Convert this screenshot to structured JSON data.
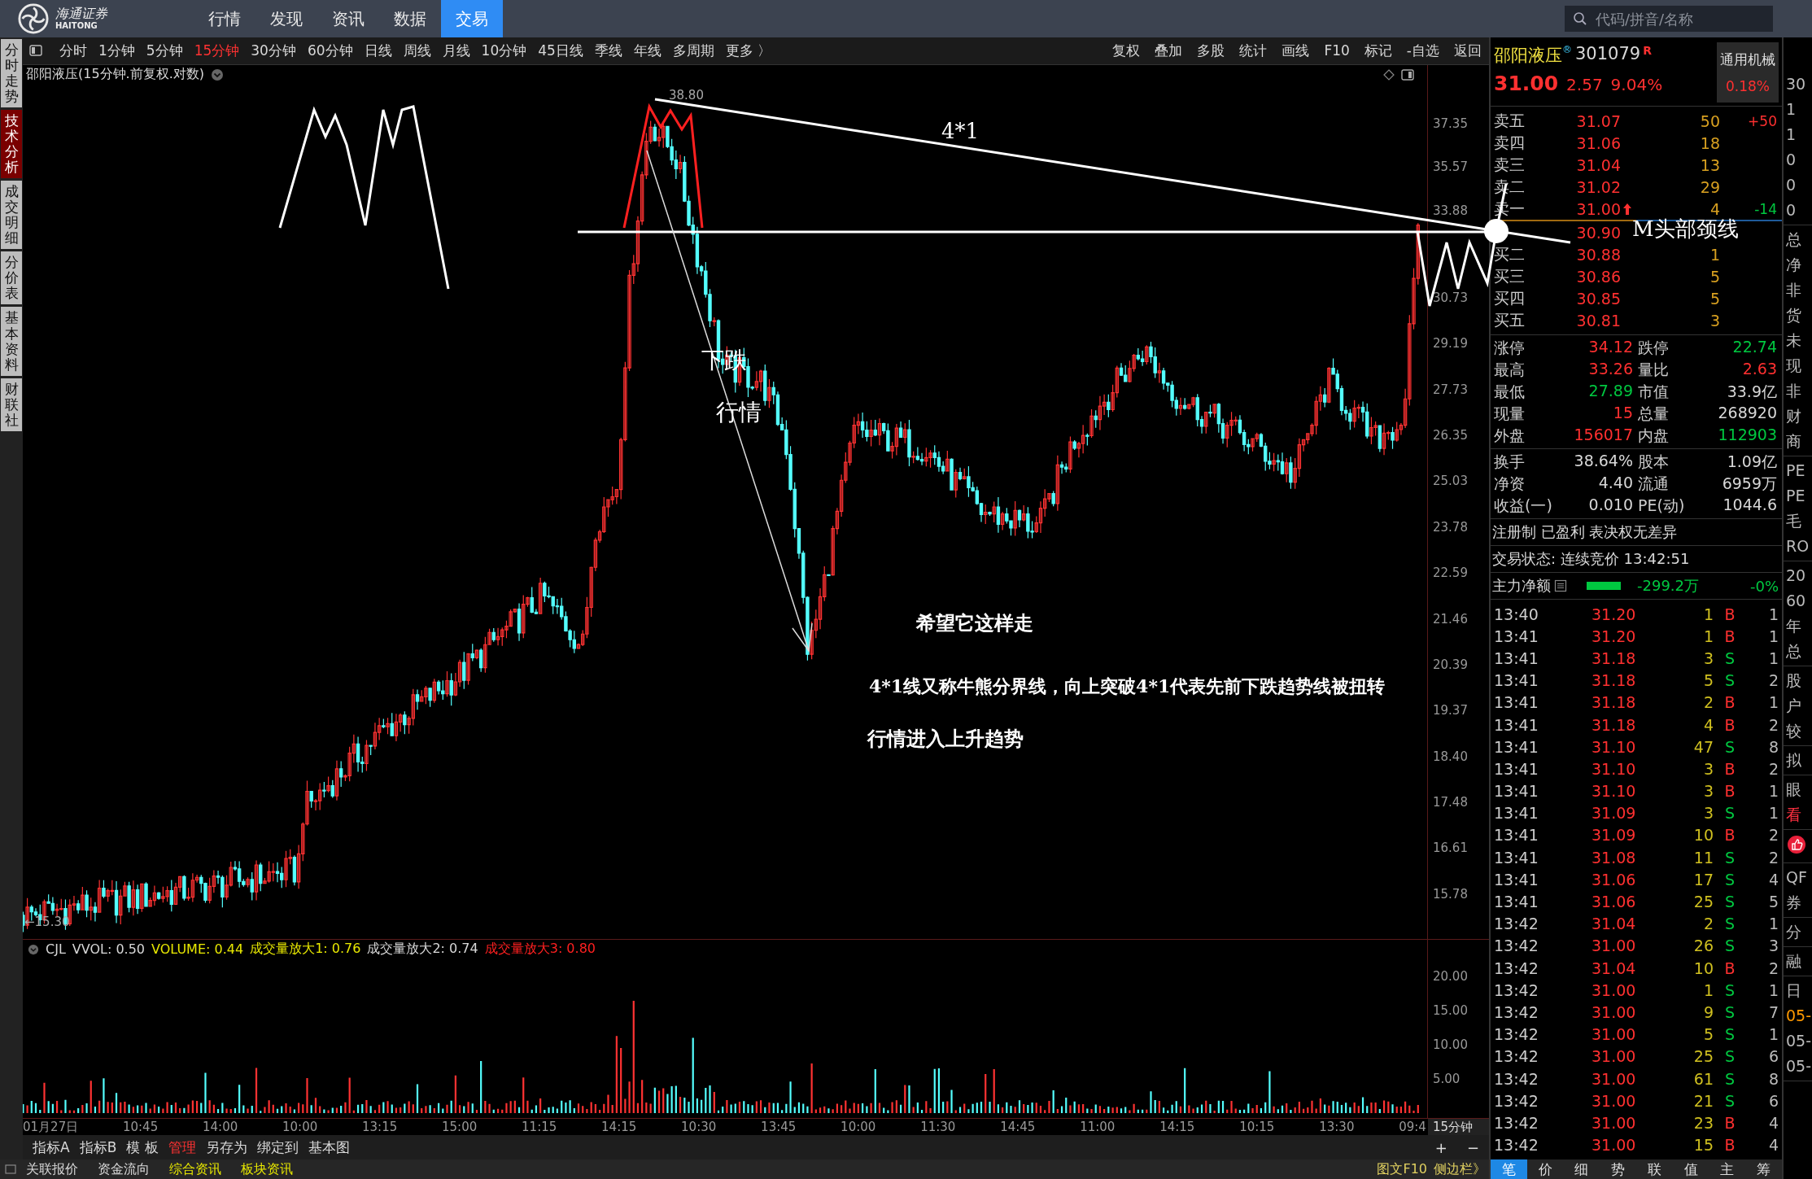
{
  "top_bar": {
    "logo_text": "海通证券",
    "logo_subtext": "HAITONG",
    "nav": [
      {
        "label": "行情",
        "selected": false
      },
      {
        "label": "发现",
        "selected": false
      },
      {
        "label": "资讯",
        "selected": false
      },
      {
        "label": "数据",
        "selected": false
      },
      {
        "label": "交易",
        "selected": true
      }
    ],
    "search": {
      "placeholder": "代码/拼音/名称"
    }
  },
  "side_tabs": [
    {
      "label": "分时走势",
      "selected": false
    },
    {
      "label": "技术分析",
      "selected": true
    },
    {
      "label": "成交明细",
      "selected": false
    },
    {
      "label": "分价表",
      "selected": false
    },
    {
      "label": "基本资料",
      "selected": false
    },
    {
      "label": "财联社",
      "selected": false
    }
  ],
  "periods": [
    {
      "label": "分时",
      "selected": false
    },
    {
      "label": "1分钟",
      "selected": false
    },
    {
      "label": "5分钟",
      "selected": false
    },
    {
      "label": "15分钟",
      "selected": true
    },
    {
      "label": "30分钟",
      "selected": false
    },
    {
      "label": "60分钟",
      "selected": false
    },
    {
      "label": "日线",
      "selected": false
    },
    {
      "label": "周线",
      "selected": false
    },
    {
      "label": "月线",
      "selected": false
    },
    {
      "label": "10分钟",
      "selected": false
    },
    {
      "label": "45日线",
      "selected": false
    },
    {
      "label": "季线",
      "selected": false
    },
    {
      "label": "年线",
      "selected": false
    },
    {
      "label": "多周期",
      "selected": false
    },
    {
      "label": "更多 〉",
      "selected": false
    }
  ],
  "tools": [
    "复权",
    "叠加",
    "多股",
    "统计",
    "画线",
    "F10",
    "标记",
    "-自选",
    "返回"
  ],
  "chart": {
    "title": "邵阳液压(15分钟.前复权.对数)",
    "high_label": "38.80",
    "low_label": "←15.30",
    "price_ticks": [
      "37.35",
      "35.57",
      "33.88",
      "30.73",
      "29.19",
      "27.73",
      "26.35",
      "25.03",
      "23.78",
      "22.59",
      "21.46",
      "20.39",
      "19.37",
      "18.40",
      "17.48",
      "16.61",
      "15.78"
    ]
  },
  "annotations": [
    {
      "text": "4*1"
    },
    {
      "text": "下跌"
    },
    {
      "text": "行情"
    },
    {
      "text": "希望它这样走"
    },
    {
      "text": "4*1线又称牛熊分界线，向上突破4*1代表先前下跌趋势线被扭转"
    },
    {
      "text": "行情进入上升趋势"
    },
    {
      "text": "M头部颈线"
    }
  ],
  "indicator": {
    "name": "CJL",
    "params": [
      {
        "text": "VVOL: 0.50",
        "color": "#d8d8d8"
      },
      {
        "text": "VOLUME: 0.44",
        "color": "#e8e800"
      },
      {
        "text": "成交量放大1: 0.76",
        "color": "#e8e800"
      },
      {
        "text": "成交量放大2: 0.74",
        "color": "#d8d8d8"
      },
      {
        "text": "成交量放大3: 0.80",
        "color": "#ff2020"
      }
    ],
    "ticks": [
      "20.00",
      "15.00",
      "10.00",
      "5.00"
    ]
  },
  "time_axis": {
    "labels": [
      "01月27日",
      "10:45",
      "14:00",
      "10:00",
      "13:15",
      "15:00",
      "11:15",
      "14:15",
      "10:30",
      "13:45",
      "10:00",
      "11:30",
      "14:45",
      "11:00",
      "14:15",
      "10:15",
      "13:30",
      "09:4"
    ],
    "period": "15分钟"
  },
  "bottom_toolbar": [
    {
      "label": "指标A",
      "selected": false
    },
    {
      "label": "指标B",
      "selected": false
    },
    {
      "label": "模 板",
      "selected": false
    },
    {
      "label": "管理",
      "selected": true
    },
    {
      "label": "另存为",
      "selected": false
    },
    {
      "label": "绑定到",
      "selected": false
    },
    {
      "label": "基本图",
      "selected": false
    }
  ],
  "zoom_buttons": [
    "+",
    "−"
  ],
  "status_bar": {
    "links": [
      {
        "label": "关联报价",
        "color": "#d8d8d8"
      },
      {
        "label": "资金流向",
        "color": "#d8d8d8"
      },
      {
        "label": "综合资讯",
        "color": "#e8e800"
      },
      {
        "label": "板块资讯",
        "color": "#e8e800"
      }
    ],
    "right": [
      "图文F10",
      "侧边栏》"
    ]
  },
  "quote": {
    "name": "邵阳液压",
    "mark": "®",
    "code": "301079",
    "badge": "R",
    "sector": "通用机械",
    "sector_change": "0.18%",
    "price": "31.00",
    "change": "2.57",
    "change_pct": "9.04%"
  },
  "order_book": {
    "asks": [
      {
        "label": "卖五",
        "price": "31.07",
        "rising": false,
        "volume": "50",
        "delta": {
          "text": "+50",
          "color": "#ff3030"
        }
      },
      {
        "label": "卖四",
        "price": "31.06",
        "rising": false,
        "volume": "18"
      },
      {
        "label": "卖三",
        "price": "31.04",
        "rising": false,
        "volume": "13"
      },
      {
        "label": "卖二",
        "price": "31.02",
        "rising": false,
        "volume": "29"
      },
      {
        "label": "卖一",
        "price": "31.00",
        "rising": true,
        "volume": "4",
        "delta": {
          "text": "-14",
          "color": "#00c840"
        }
      }
    ],
    "bids": [
      {
        "price": "30.90"
      },
      {
        "label": "买二",
        "price": "30.88",
        "volume": "1"
      },
      {
        "label": "买三",
        "price": "30.86",
        "volume": "5"
      },
      {
        "label": "买四",
        "price": "30.85",
        "volume": "5"
      },
      {
        "label": "买五",
        "price": "30.81",
        "volume": "3"
      }
    ]
  },
  "stats": [
    [
      {
        "label": "涨停",
        "value": "34.12",
        "color": "#ff3030"
      },
      {
        "label": "跌停",
        "value": "22.74",
        "color": "#00c840"
      }
    ],
    [
      {
        "label": "最高",
        "value": "33.26",
        "color": "#ff3030"
      },
      {
        "label": "量比",
        "value": "2.63",
        "color": "#ff3030"
      }
    ],
    [
      {
        "label": "最低",
        "value": "27.89",
        "color": "#00c840"
      },
      {
        "label": "市值",
        "value": "33.9亿",
        "color": "#d8d8d8"
      }
    ],
    [
      {
        "label": "现量",
        "value": "15",
        "color": "#ff3030"
      },
      {
        "label": "总量",
        "value": "268920",
        "color": "#d8d8d8"
      }
    ],
    [
      {
        "label": "外盘",
        "value": "156017",
        "color": "#ff3030"
      },
      {
        "label": "内盘",
        "value": "112903",
        "color": "#00c840"
      }
    ]
  ],
  "fundamentals": [
    [
      {
        "label": "换手",
        "value": "38.64%"
      },
      {
        "label": "股本",
        "value": "1.09亿"
      }
    ],
    [
      {
        "label": "净资",
        "value": "4.40"
      },
      {
        "label": "流通",
        "value": "6959万"
      }
    ],
    [
      {
        "label": "收益(一)",
        "value": "0.010"
      },
      {
        "label": "PE(动)",
        "value": "1044.6"
      }
    ]
  ],
  "tags": "注册制 已盈利 表决权无差异",
  "trade_status": "交易状态: 连续竞价 13:42:51",
  "main_flow": {
    "label": "主力净额",
    "value": "-299.2万",
    "pct": "-0%"
  },
  "trades": [
    {
      "time": "13:40",
      "price": "31.20",
      "volume": "1",
      "side": "B",
      "color": "#ff3030",
      "count": "1"
    },
    {
      "time": "13:41",
      "price": "31.20",
      "volume": "1",
      "side": "B",
      "color": "#ff3030",
      "count": "1"
    },
    {
      "time": "13:41",
      "price": "31.18",
      "volume": "3",
      "side": "S",
      "color": "#00c840",
      "count": "1"
    },
    {
      "time": "13:41",
      "price": "31.18",
      "volume": "5",
      "side": "S",
      "color": "#00c840",
      "count": "2"
    },
    {
      "time": "13:41",
      "price": "31.18",
      "volume": "2",
      "side": "B",
      "color": "#ff3030",
      "count": "1"
    },
    {
      "time": "13:41",
      "price": "31.18",
      "volume": "4",
      "side": "B",
      "color": "#ff3030",
      "count": "2"
    },
    {
      "time": "13:41",
      "price": "31.10",
      "volume": "47",
      "side": "S",
      "color": "#00c840",
      "count": "8"
    },
    {
      "time": "13:41",
      "price": "31.10",
      "volume": "3",
      "side": "B",
      "color": "#ff3030",
      "count": "2"
    },
    {
      "time": "13:41",
      "price": "31.10",
      "volume": "3",
      "side": "B",
      "color": "#ff3030",
      "count": "1"
    },
    {
      "time": "13:41",
      "price": "31.09",
      "volume": "3",
      "side": "S",
      "color": "#00c840",
      "count": "1"
    },
    {
      "time": "13:41",
      "price": "31.09",
      "volume": "10",
      "side": "B",
      "color": "#ff3030",
      "count": "2"
    },
    {
      "time": "13:41",
      "price": "31.08",
      "volume": "11",
      "side": "S",
      "color": "#00c840",
      "count": "2"
    },
    {
      "time": "13:41",
      "price": "31.06",
      "volume": "17",
      "side": "S",
      "color": "#00c840",
      "count": "4"
    },
    {
      "time": "13:41",
      "price": "31.06",
      "volume": "25",
      "side": "S",
      "color": "#00c840",
      "count": "5"
    },
    {
      "time": "13:42",
      "price": "31.04",
      "volume": "2",
      "side": "S",
      "color": "#00c840",
      "count": "1"
    },
    {
      "time": "13:42",
      "price": "31.00",
      "volume": "26",
      "side": "S",
      "color": "#00c840",
      "count": "3"
    },
    {
      "time": "13:42",
      "price": "31.04",
      "volume": "10",
      "side": "B",
      "color": "#ff3030",
      "count": "2"
    },
    {
      "time": "13:42",
      "price": "31.00",
      "volume": "1",
      "side": "S",
      "color": "#00c840",
      "count": "1"
    },
    {
      "time": "13:42",
      "price": "31.00",
      "volume": "9",
      "side": "S",
      "color": "#00c840",
      "count": "7"
    },
    {
      "time": "13:42",
      "price": "31.00",
      "volume": "5",
      "side": "S",
      "color": "#00c840",
      "count": "1"
    },
    {
      "time": "13:42",
      "price": "31.00",
      "volume": "25",
      "side": "S",
      "color": "#00c840",
      "count": "6"
    },
    {
      "time": "13:42",
      "price": "31.00",
      "volume": "61",
      "side": "S",
      "color": "#00c840",
      "count": "8"
    },
    {
      "time": "13:42",
      "price": "31.00",
      "volume": "21",
      "side": "S",
      "color": "#00c840",
      "count": "6"
    },
    {
      "time": "13:42",
      "price": "31.00",
      "volume": "23",
      "side": "B",
      "color": "#ff3030",
      "count": "4"
    },
    {
      "time": "13:42",
      "price": "31.00",
      "volume": "15",
      "side": "B",
      "color": "#ff3030",
      "count": "4"
    }
  ],
  "panel_tabs": [
    {
      "label": "笔",
      "selected": true
    },
    {
      "label": "价",
      "selected": false
    },
    {
      "label": "细",
      "selected": false
    },
    {
      "label": "势",
      "selected": false
    },
    {
      "label": "联",
      "selected": false
    },
    {
      "label": "值",
      "selected": false
    },
    {
      "label": "主",
      "selected": false
    },
    {
      "label": "筹",
      "selected": false
    }
  ],
  "edge_column": [
    {
      "kind": "text",
      "items": [
        {
          "text": "30"
        },
        {
          "text": "1"
        },
        {
          "text": "1"
        },
        {
          "text": "0"
        },
        {
          "text": "0"
        },
        {
          "text": "0"
        }
      ]
    },
    {
      "kind": "text",
      "items": [
        {
          "text": "总"
        },
        {
          "text": "净"
        },
        {
          "text": "非"
        },
        {
          "text": "货"
        },
        {
          "text": "未"
        },
        {
          "text": "现"
        },
        {
          "text": "非"
        },
        {
          "text": "财"
        },
        {
          "text": "商"
        }
      ]
    },
    {
      "kind": "text",
      "items": [
        {
          "text": "PE"
        },
        {
          "text": "PE"
        },
        {
          "text": "毛"
        },
        {
          "text": "RO"
        }
      ]
    },
    {
      "kind": "text",
      "items": [
        {
          "text": "20"
        },
        {
          "text": "60"
        },
        {
          "text": "年"
        },
        {
          "text": "总"
        }
      ]
    },
    {
      "kind": "text",
      "items": [
        {
          "text": "股"
        },
        {
          "text": "户"
        },
        {
          "text": "较"
        }
      ]
    },
    {
      "kind": "text",
      "items": [
        {
          "text": "拟"
        }
      ]
    },
    {
      "kind": "text",
      "items": [
        {
          "text": "眼"
        },
        {
          "text": "看",
          "color": "#ff3040"
        }
      ]
    },
    {
      "kind": "like"
    },
    {
      "kind": "text",
      "items": [
        {
          "text": "QF"
        },
        {
          "text": "券"
        }
      ]
    },
    {
      "kind": "text",
      "items": [
        {
          "text": "分"
        }
      ]
    },
    {
      "kind": "text",
      "items": [
        {
          "text": "融"
        }
      ]
    },
    {
      "kind": "text",
      "items": [
        {
          "text": "日"
        },
        {
          "text": "05-",
          "color": "#ff9900"
        },
        {
          "text": "05-"
        },
        {
          "text": "05-"
        }
      ]
    }
  ]
}
